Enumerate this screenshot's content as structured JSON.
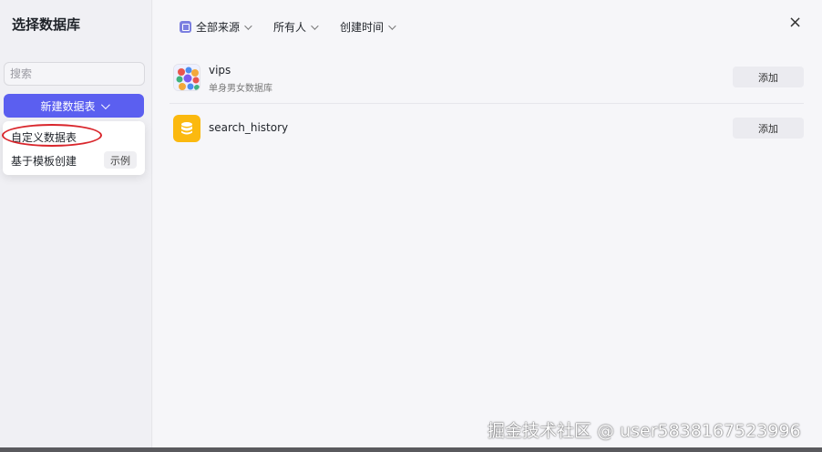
{
  "sidebar": {
    "title": "选择数据库",
    "search_placeholder": "搜索",
    "new_button_label": "新建数据表",
    "dropdown": {
      "custom_label": "自定义数据表",
      "template_label": "基于模板创建",
      "example_tag": "示例"
    }
  },
  "filters": {
    "source": "全部来源",
    "owner": "所有人",
    "created": "创建时间"
  },
  "databases": [
    {
      "name": "vips",
      "description": "单身男女数据库",
      "action": "添加",
      "icon": "avatar-collage-icon"
    },
    {
      "name": "search_history",
      "description": "",
      "action": "添加",
      "icon": "database-icon"
    }
  ],
  "close_icon": "×",
  "watermark": "掘金技术社区 @ user5838167523996",
  "colors": {
    "accent": "#5b5ff0",
    "highlight_ring": "#d9262c",
    "db_icon": "#fbb90f"
  }
}
